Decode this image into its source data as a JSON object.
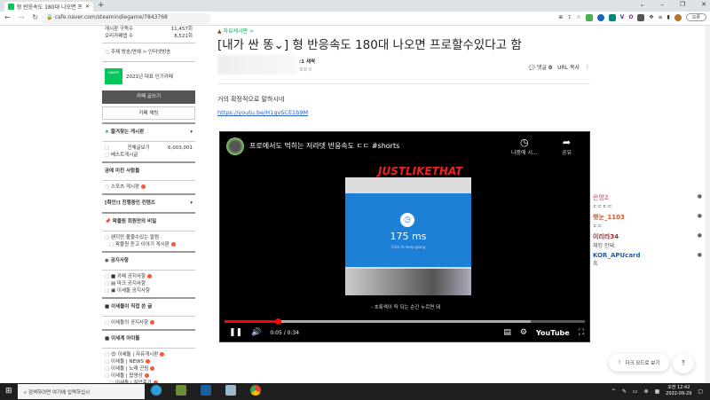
{
  "browser": {
    "tab_title": "형 반응속도 180대 나오면 프",
    "url": "cafe.naver.com/steamindiegame/7843768",
    "profile_label": "오류"
  },
  "sidebar": {
    "stats": [
      {
        "label": "게시판 구독수",
        "value": "11,457회"
      },
      {
        "label": "오리카페앱 수",
        "value": "8,521회"
      }
    ],
    "topic": "주제 방송/연예 > 인터넷방송",
    "award": "2021년 대표 인기카페",
    "award_badge": "NAVER 대표카페",
    "write_button": "카페 글쓰기",
    "chat_button": "카페 채팅",
    "favorites": "즐겨찾는 게시판",
    "all_posts": "전체글보기",
    "all_posts_count": "6,003,001",
    "best_posts": "베스트게시글",
    "section1": "공에 미친 사람들",
    "s1_items": [
      "스포츠 게시판"
    ],
    "section2": "[확인!] 진행중인 컨텐츠",
    "section3": "왁물원 회원만의 비밀",
    "s3_items": [
      "왠지만 볼줄수있는 칼럼",
      "왁물원 듣고 이야기 게시판"
    ],
    "section4": "공지사항",
    "s4_items": [
      "■ 카페 공지사항",
      "▤ 마크 공지사항",
      "▣ 이세돌 공지사항"
    ],
    "section5": "■ 이세돌이 직접 쓴 글",
    "s5_items": [
      "이세돌의 공지사항"
    ],
    "section6": "■ 이세계 아이돌",
    "s6_items": [
      "이세돌 | 자유게시판",
      "이세돌 | NEWS",
      "이세돌 | 노래 곤팅",
      "이세돌 | 팝영상",
      "이세돌 | 직업후기"
    ]
  },
  "article": {
    "board": "자유게시판 >",
    "title": "[내가 싼 똥⌄] 형 반응속도 180대 나오면 프로할수있다고 함",
    "level": ":1 새싹",
    "views": "조회 0",
    "comments_label": "댓글",
    "comments_count": "0",
    "url_copy": "URL 복사",
    "body": "거의 확정적으로 말하시네",
    "link": "https://youtu.be/H1gvSCE1b9M"
  },
  "video": {
    "title": "프로에서도 먹히는 저라뎃 반응속도 ㄷㄷ #shorts",
    "watch_later": "나중에 시...",
    "share": "공유",
    "overlay_text": "JUSTLIKETHAT",
    "reaction_time": "175 ms",
    "reaction_sub": "Click to keep going",
    "caption": "- 초록색이 딱 되는 순간 누르면 돼",
    "time": "0:05 / 0:34",
    "progress": 0.147,
    "buffered": 0.85,
    "brand": "YouTube"
  },
  "chat": [
    {
      "name": "은명2",
      "text": "ㄷㄷㄷㄷ",
      "color": "#e07aa0"
    },
    {
      "name": "햇눈_1103",
      "text": "ㄷㄷ",
      "color": "#d2582a"
    },
    {
      "name": "이리라34",
      "text": "체킹 안돼",
      "color": "#a0282a"
    },
    {
      "name": "KOR_APUcard",
      "text": "흑",
      "color": "#1e5fb0"
    }
  ],
  "floating": {
    "dark_mode": "다크 모드로 보기"
  },
  "taskbar": {
    "search_placeholder": "검색하려면 여기에 입력하십시",
    "time": "오전 12:42",
    "date": "2022-09-29"
  }
}
